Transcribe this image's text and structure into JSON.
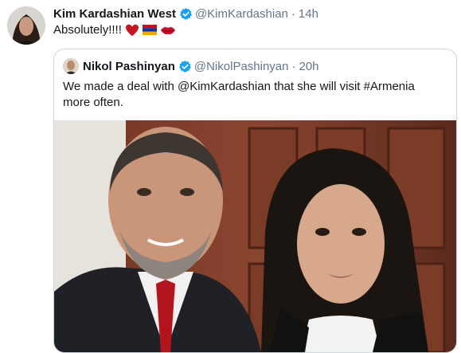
{
  "tweet": {
    "author_name": "Kim Kardashian West",
    "handle": "@KimKardashian",
    "time": "14h",
    "separator": "·",
    "text": "Absolutely!!!!",
    "emojis": [
      "heart-emoji",
      "armenia-flag-emoji",
      "kiss-emoji"
    ]
  },
  "quoted_tweet": {
    "author_name": "Nikol Pashinyan",
    "handle": "@NikolPashinyan",
    "time": "20h",
    "separator": "·",
    "text": "We made a deal with @KimKardashian that she will visit #Armenia more often."
  },
  "colors": {
    "verified_blue": "#1da1f2",
    "muted_text": "#657786",
    "border": "#ccd6dd"
  }
}
